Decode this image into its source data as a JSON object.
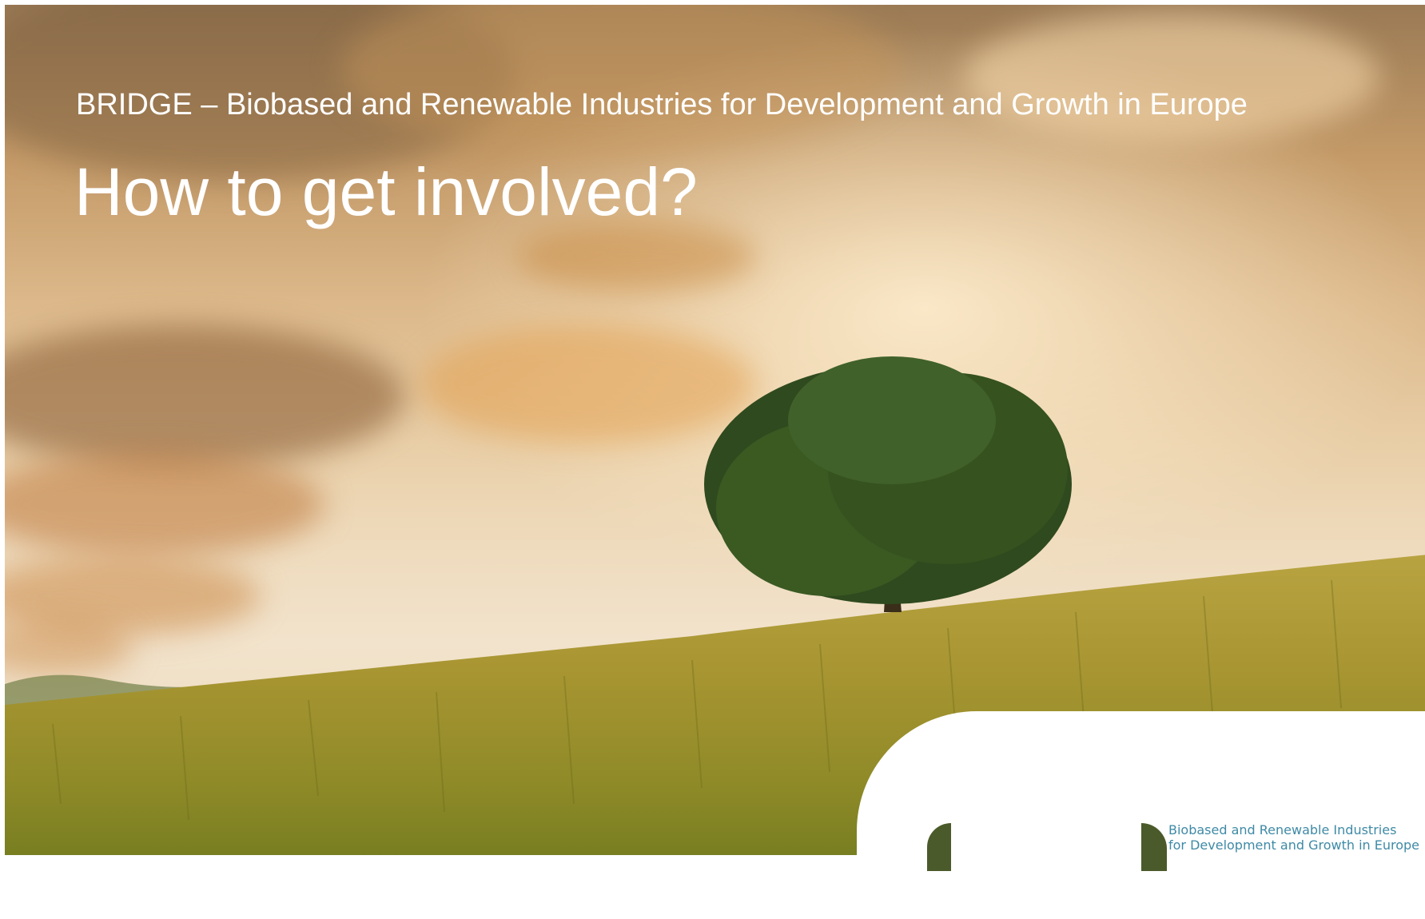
{
  "slide": {
    "subtitle": "BRIDGE – Biobased and Renewable Industries for Development and Growth in Europe",
    "title": "How to get involved?"
  },
  "logo": {
    "line1": "Biobased and Renewable Industries",
    "line2": "for Development and Growth in Europe",
    "mark_color": "#4a5a2a",
    "text_color": "#3f8aa6"
  },
  "background": {
    "scene": "wheat-field-tree-sunset-image"
  }
}
